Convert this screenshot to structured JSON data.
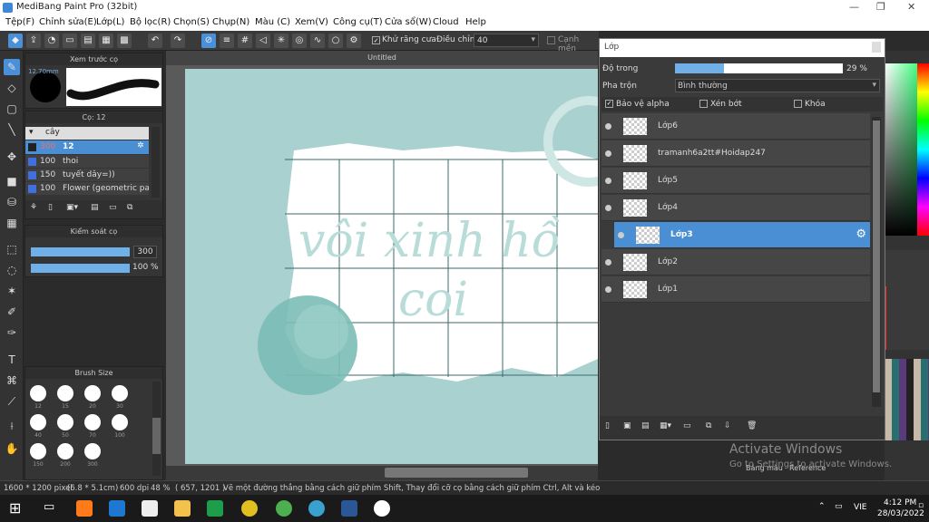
{
  "window": {
    "title": "MediBang Paint Pro (32bit)",
    "minimize": "—",
    "maximize": "❐",
    "close": "✕"
  },
  "menu": [
    "Tệp(F)",
    "Chỉnh sửa(E)",
    "Lớp(L)",
    "Bộ lọc(R)",
    "Chọn(S)",
    "Chụp(N)",
    "Màu (C)",
    "Xem(V)",
    "Công cụ(T)",
    "Cửa sổ(W)",
    "Cloud",
    "Help"
  ],
  "toolbar": {
    "antialias_label": "Khử răng cưa",
    "adjust_label": "Điều chỉnh",
    "adjust_value": "40",
    "edge_label": "Cạnh mền"
  },
  "canvas": {
    "tab_title": "Untitled",
    "text_line1": "vôi xinh hồ",
    "text_line2": "coi"
  },
  "brush_preview": {
    "title": "Xem trước cọ",
    "size_label": "12.70mm"
  },
  "brush_panel": {
    "title": "Cọ: 12",
    "group": "cây",
    "items": [
      {
        "size": "300",
        "name": "12",
        "selected": true
      },
      {
        "size": "100",
        "name": "thoi"
      },
      {
        "size": "150",
        "name": "tuyết dây=))"
      },
      {
        "size": "100",
        "name": "Flower (geometric patt"
      }
    ]
  },
  "brush_control": {
    "title": "Kiểm soát cọ",
    "size_value": "300",
    "opacity_value": "100 %",
    "size_fraction": 1.0,
    "opacity_fraction": 1.0
  },
  "brush_size": {
    "title": "Brush Size",
    "sizes": [
      "12",
      "15",
      "20",
      "30",
      "40",
      "50",
      "70",
      "100",
      "150",
      "200",
      "300"
    ]
  },
  "layer_panel": {
    "title": "Lớp",
    "opacity_label": "Độ trong",
    "opacity_value": "29 %",
    "opacity_fraction": 0.29,
    "blend_label": "Pha trộn",
    "blend_value": "Bình thường",
    "protect_alpha": "Bảo vệ alpha",
    "clipping": "Xén bớt",
    "lock": "Khóa",
    "layers": [
      {
        "name": "Lớp6"
      },
      {
        "name": "tramanh6a2tt#Hoidap247"
      },
      {
        "name": "Lớp5"
      },
      {
        "name": "Lớp4"
      },
      {
        "name": "Lớp3",
        "selected": true
      },
      {
        "name": "Lớp2"
      },
      {
        "name": "Lớp1"
      }
    ]
  },
  "color_tabs": {
    "tab1": "Bảng màu",
    "tab2": "Reference"
  },
  "watermark": {
    "line1": "Activate Windows",
    "line2": "Go to Settings to activate Windows."
  },
  "status": {
    "dims": "1600 * 1200 pixel",
    "cm": "(6.8 * 5.1cm)",
    "dpi": "600 dpi",
    "zoom": "48 %",
    "coords": "( 657, 1201 )",
    "hint": "Vẽ một đường thẳng bằng cách giữ phím Shift, Thay đổi cỡ cọ bằng cách giữ phím Ctrl, Alt và kéo"
  },
  "taskbar": {
    "lang": "VIE",
    "time": "4:12 PM",
    "date": "28/03/2022"
  },
  "colors": {
    "accent": "#4a8fd3",
    "canvas_bg": "#a9d1d0",
    "circle": "#7bbdb6"
  }
}
